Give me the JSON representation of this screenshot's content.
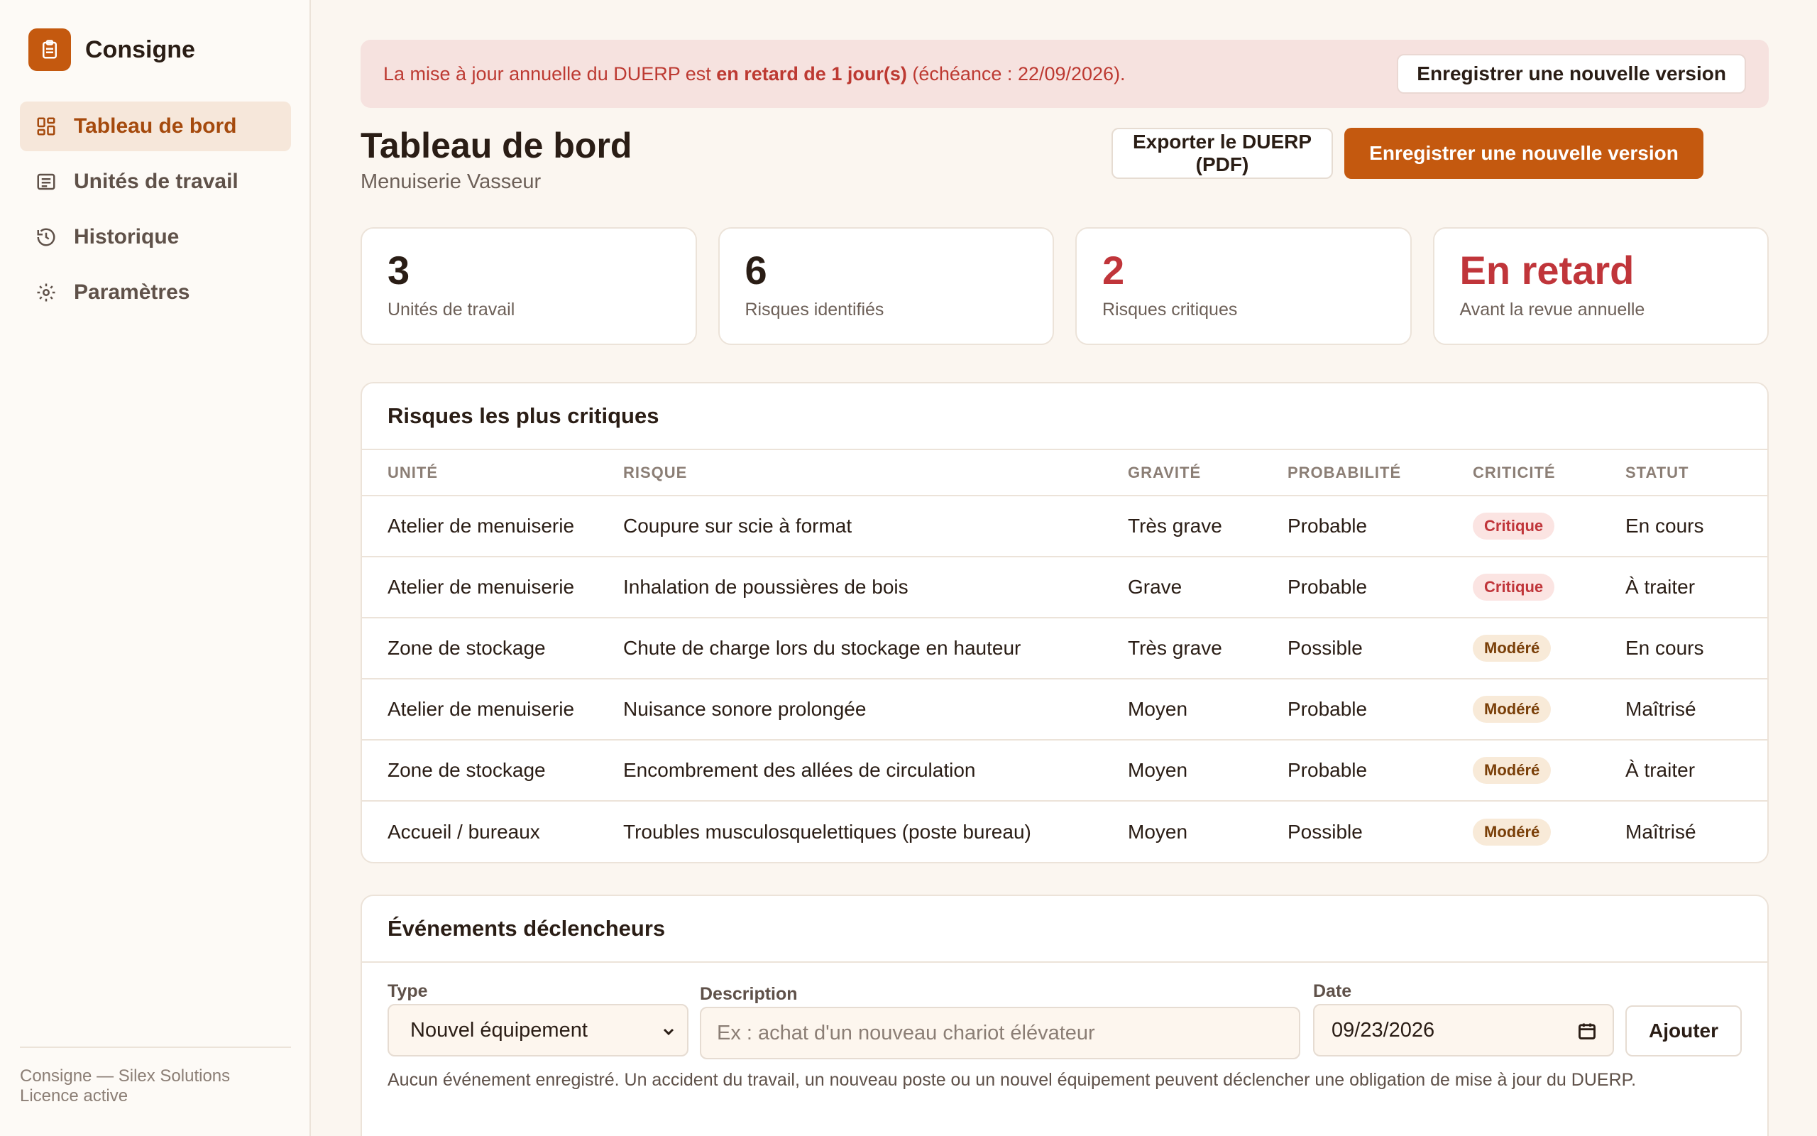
{
  "app": {
    "name": "Consigne",
    "logo_icon": "clipboard-icon",
    "accent": "#c4590f"
  },
  "sidebar": {
    "items": [
      {
        "label": "Tableau de bord",
        "icon": "dashboard-icon",
        "active": true
      },
      {
        "label": "Unités de travail",
        "icon": "list-icon"
      },
      {
        "label": "Historique",
        "icon": "history-icon"
      },
      {
        "label": "Paramètres",
        "icon": "gear-icon"
      }
    ],
    "footer_line1": "Consigne — Silex Solutions",
    "footer_line2": "Licence active"
  },
  "alert": {
    "prefix": "La mise à jour annuelle du DUERP est ",
    "emphasis": "en retard de 1 jour(s)",
    "suffix": " (échéance : 22/09/2026).",
    "button": "Enregistrer une nouvelle version"
  },
  "header": {
    "title": "Tableau de bord",
    "subtitle": "Menuiserie Vasseur",
    "export_button": "Exporter le DUERP (PDF)",
    "primary_button": "Enregistrer une nouvelle version"
  },
  "stats": [
    {
      "value": "3",
      "label": "Unités de travail"
    },
    {
      "value": "6",
      "label": "Risques identifiés"
    },
    {
      "value": "2",
      "label": "Risques critiques"
    },
    {
      "value": "En retard",
      "label": "Avant la revue annuelle"
    }
  ],
  "risks": {
    "title": "Risques les plus critiques",
    "columns": [
      "UNITÉ",
      "RISQUE",
      "GRAVITÉ",
      "PROBABILITÉ",
      "CRITICITÉ",
      "STATUT"
    ],
    "rows": [
      {
        "unit": "Atelier de menuiserie",
        "risk": "Coupure sur scie à format",
        "severity": "Très grave",
        "probability": "Probable",
        "criticity": "Critique",
        "status": "En cours"
      },
      {
        "unit": "Atelier de menuiserie",
        "risk": "Inhalation de poussières de bois",
        "severity": "Grave",
        "probability": "Probable",
        "criticity": "Critique",
        "status": "À traiter"
      },
      {
        "unit": "Zone de stockage",
        "risk": "Chute de charge lors du stockage en hauteur",
        "severity": "Très grave",
        "probability": "Possible",
        "criticity": "Modéré",
        "status": "En cours"
      },
      {
        "unit": "Atelier de menuiserie",
        "risk": "Nuisance sonore prolongée",
        "severity": "Moyen",
        "probability": "Probable",
        "criticity": "Modéré",
        "status": "Maîtrisé"
      },
      {
        "unit": "Zone de stockage",
        "risk": "Encombrement des allées de circulation",
        "severity": "Moyen",
        "probability": "Probable",
        "criticity": "Modéré",
        "status": "À traiter"
      },
      {
        "unit": "Accueil / bureaux",
        "risk": "Troubles musculosquelettiques (poste bureau)",
        "severity": "Moyen",
        "probability": "Possible",
        "criticity": "Modéré",
        "status": "Maîtrisé"
      }
    ]
  },
  "events": {
    "title": "Événements déclencheurs",
    "type_label": "Type",
    "type_value": "Nouvel équipement",
    "description_label": "Description",
    "description_placeholder": "Ex : achat d'un nouveau chariot élévateur",
    "date_label": "Date",
    "date_value": "09/23/2026",
    "add_button": "Ajouter",
    "empty_text": "Aucun événement enregistré. Un accident du travail, un nouveau poste ou un nouvel équipement peuvent déclencher une obligation de mise à jour du DUERP."
  }
}
